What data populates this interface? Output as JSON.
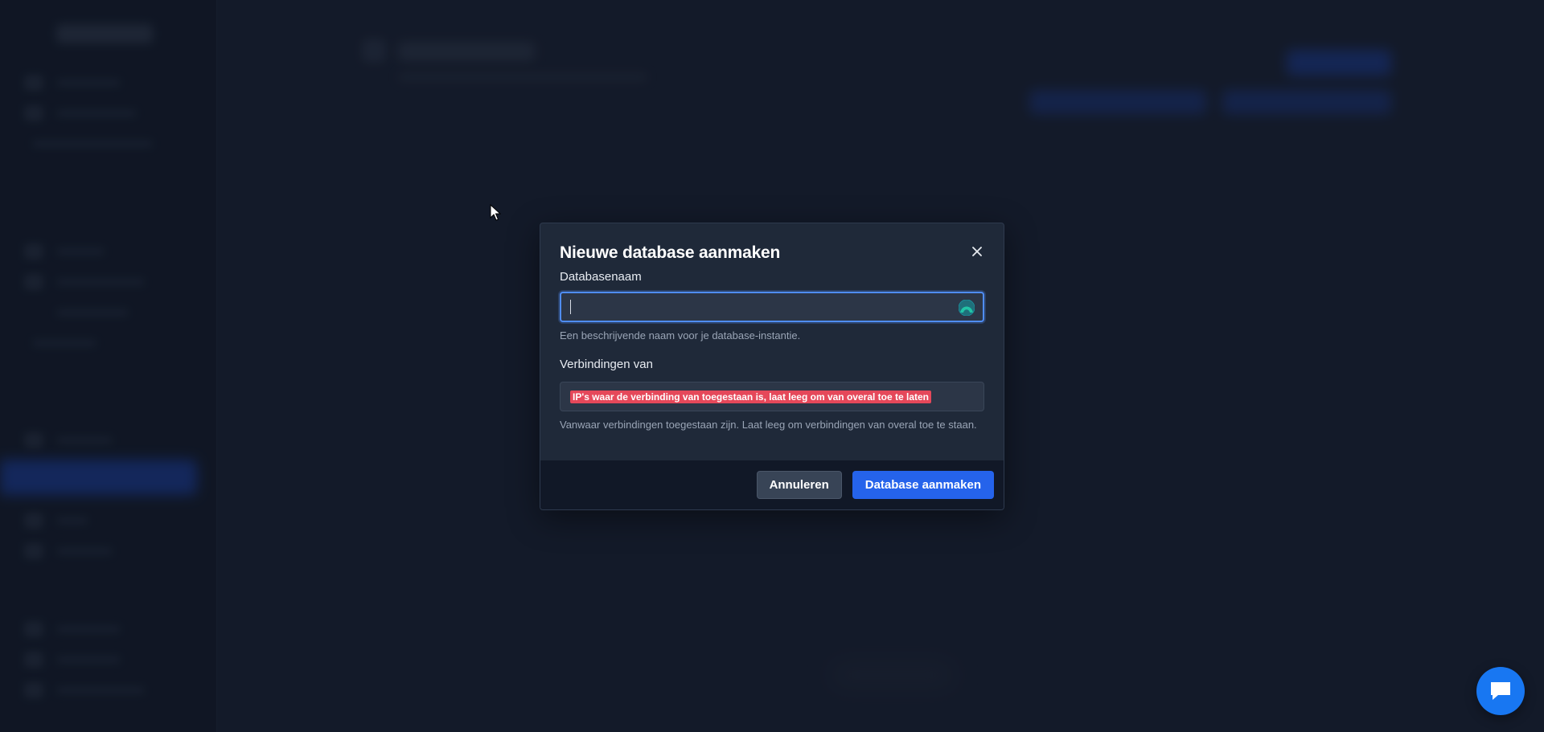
{
  "modal": {
    "title": "Nieuwe database aanmaken",
    "close_icon": "close-icon",
    "fields": {
      "name": {
        "label": "Databasenaam",
        "value": "",
        "placeholder": "",
        "help": "Een beschrijvende naam voor je database-instantie.",
        "icon": "password-manager-icon"
      },
      "connections": {
        "label": "Verbindingen van",
        "placeholder": "IP's waar de verbinding van toegestaan is, laat leeg om van overal toe te laten",
        "help": "Vanwaar verbindingen toegestaan zijn. Laat leeg om verbindingen van overal toe te staan."
      }
    },
    "buttons": {
      "cancel": "Annuleren",
      "submit": "Database aanmaken"
    }
  },
  "chat": {
    "icon": "chat-icon"
  },
  "colors": {
    "primary": "#2563eb",
    "focus_border": "#4f8df5",
    "modal_bg": "#1f2939",
    "footer_bg": "#111827",
    "placeholder_highlight": "#e5485a"
  }
}
